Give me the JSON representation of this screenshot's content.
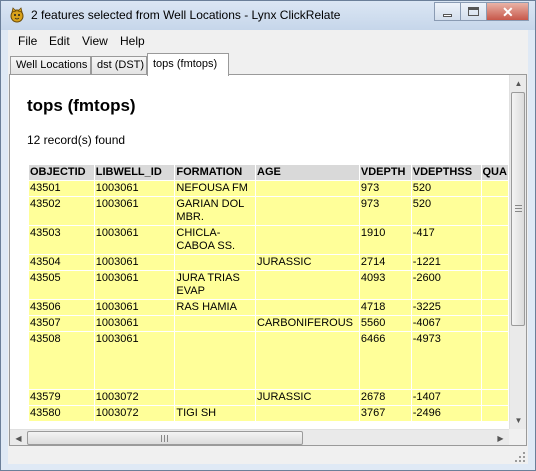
{
  "window": {
    "title": "2 features selected from Well Locations - Lynx ClickRelate",
    "app_icon": "lynx-icon"
  },
  "menu": [
    "File",
    "Edit",
    "View",
    "Help"
  ],
  "tabs": [
    {
      "label": "Well Locations",
      "active": false
    },
    {
      "label": "dst (DST)",
      "active": false
    },
    {
      "label": "tops (fmtops)",
      "active": true
    }
  ],
  "report": {
    "heading": "tops (fmtops)",
    "record_count": "12 record(s) found"
  },
  "table": {
    "columns": [
      "OBJECTID",
      "LIBWELL_ID",
      "FORMATION",
      "AGE",
      "VDEPTH",
      "VDEPTHSS",
      "QUA"
    ],
    "rows": [
      [
        "43501",
        "1003061",
        "NEFOUSA FM",
        "",
        "973",
        "520",
        ""
      ],
      [
        "43502",
        "1003061",
        "GARIAN DOL MBR.",
        "",
        "973",
        "520",
        ""
      ],
      [
        "43503",
        "1003061",
        "CHICLA-CABOA SS.",
        "",
        "1910",
        "-417",
        ""
      ],
      [
        "43504",
        "1003061",
        "",
        "JURASSIC",
        "2714",
        "-1221",
        ""
      ],
      [
        "43505",
        "1003061",
        "JURA TRIAS EVAP",
        "",
        "4093",
        "-2600",
        ""
      ],
      [
        "43506",
        "1003061",
        "RAS HAMIA",
        "",
        "4718",
        "-3225",
        ""
      ],
      [
        "43507",
        "1003061",
        "",
        "CARBONIFEROUS",
        "5560",
        "-4067",
        ""
      ],
      [
        "43508",
        "1003061",
        "",
        "",
        "6466",
        "-4973",
        ""
      ],
      [
        "43579",
        "1003072",
        "",
        "JURASSIC",
        "2678",
        "-1407",
        ""
      ],
      [
        "43580",
        "1003072",
        "TIGI SH",
        "",
        "3767",
        "-2496",
        ""
      ]
    ]
  },
  "colors": {
    "cell_background": "#ffff99",
    "header_background": "#d9d9d9",
    "title_bar": "#c6d6ea"
  }
}
